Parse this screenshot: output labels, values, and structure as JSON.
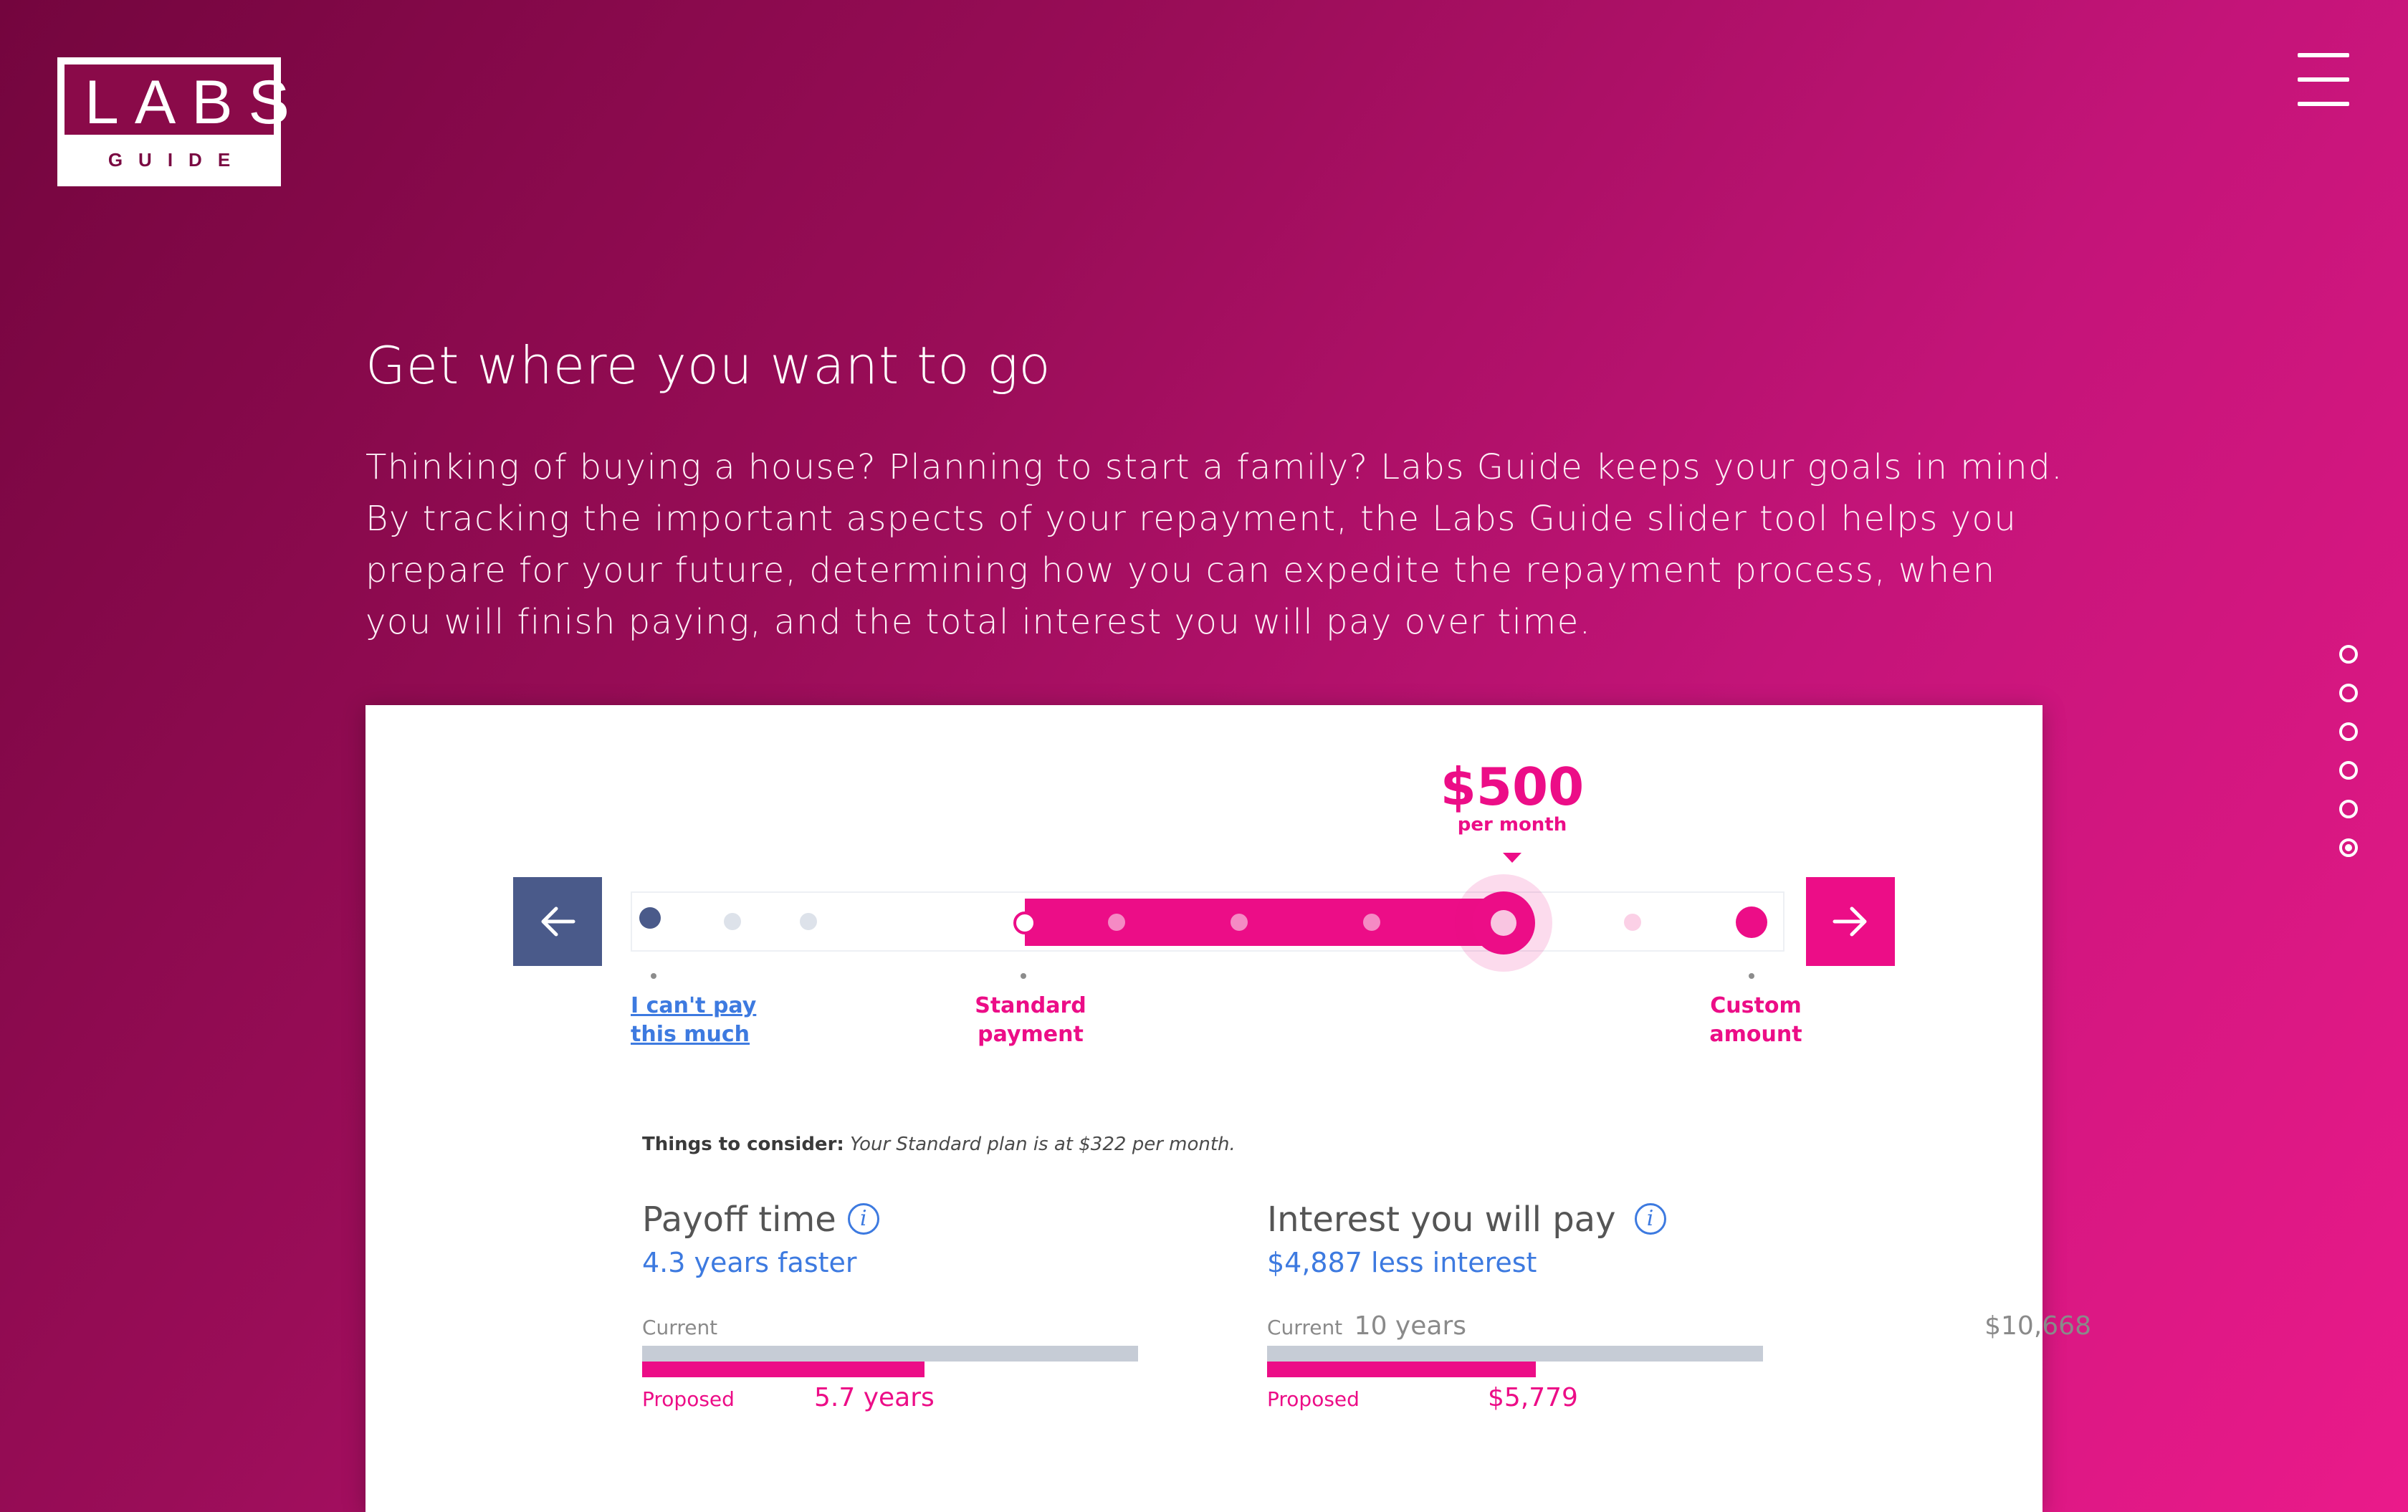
{
  "logo": {
    "word": "LABS",
    "sub": "GUIDE"
  },
  "intro": {
    "heading": "Get where you want to go",
    "body": "Thinking of buying a house? Planning to start a family? Labs Guide keeps your goals in mind. By tracking the important aspects of your repayment, the Labs Guide slider tool helps you prepare for your future, determining how you can expedite the repayment process, when you will finish paying, and the total interest you will pay over time."
  },
  "slider": {
    "amount": "$500",
    "amount_unit": "per month",
    "label_low_line1": "I can't pay",
    "label_low_line2": "this much",
    "label_standard_line1": "Standard",
    "label_standard_line2": "payment",
    "label_custom_line1": "Custom",
    "label_custom_line2": "amount",
    "fill_start_fraction": 0.37,
    "fill_end_fraction": 0.82
  },
  "consider": {
    "label": "Things to consider:",
    "text": "Your Standard plan is at $322 per month."
  },
  "payoff": {
    "title": "Payoff time",
    "subtitle": "4.3 years faster",
    "current_label": "Current",
    "current_value": "10 years",
    "proposed_label": "Proposed",
    "proposed_value": "5.7 years",
    "current_years": 10,
    "proposed_years": 5.7
  },
  "interest": {
    "title": "Interest you will pay",
    "subtitle": "$4,887 less interest",
    "current_label": "Current",
    "current_value": "$10,668",
    "proposed_label": "Proposed",
    "proposed_value": "$5,779",
    "current_amount": 10668,
    "proposed_amount": 5779
  },
  "dot_nav": {
    "count": 6,
    "active_index": 5
  },
  "colors": {
    "accent": "#ec0d87",
    "navy": "#4a5a8a",
    "link": "#3d7ae0"
  }
}
